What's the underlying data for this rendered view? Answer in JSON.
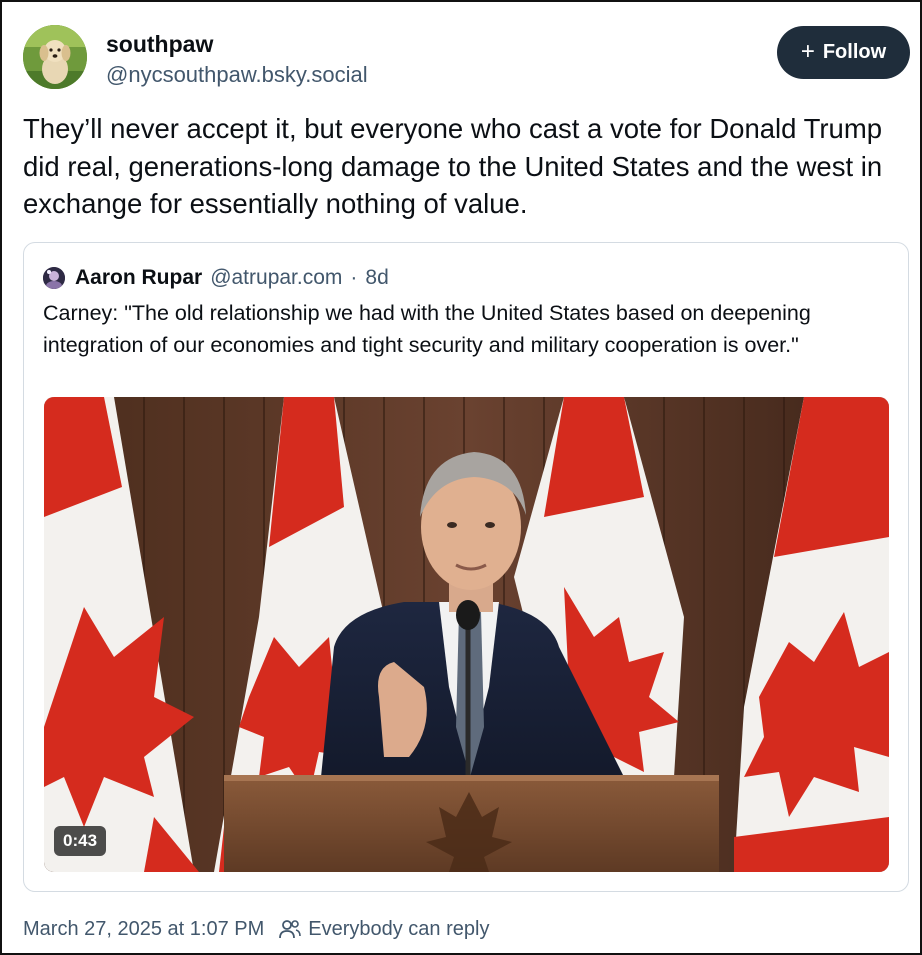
{
  "post": {
    "author": {
      "display_name": "southpaw",
      "handle": "@nycsouthpaw.bsky.social",
      "avatar_icon": "dog-avatar"
    },
    "follow_button": {
      "label": "Follow",
      "icon": "plus-icon"
    },
    "text": "They’ll never accept it, but everyone who cast a vote for Donald Trump did real, generations-long damage to the United States and the west in exchange for essentially nothing of value.",
    "timestamp": "March 27, 2025 at 1:07 PM",
    "reply_setting": {
      "label": "Everybody can reply",
      "icon": "people-icon"
    }
  },
  "quote": {
    "author": {
      "display_name": "Aaron Rupar",
      "handle": "@atrupar.com",
      "separator": "·",
      "age": "8d"
    },
    "text": "Carney: \"The old relationship we had with the United States based on deepening integration of our economies and tight security and military cooperation is over.\"",
    "video": {
      "duration": "0:43",
      "thumbnail": "speaker-at-podium-with-canadian-flags"
    }
  },
  "colors": {
    "follow_bg": "#1f2d3b",
    "muted_text": "#42576c",
    "border": "#d4dbe2",
    "flag_red": "#d52b1e"
  }
}
